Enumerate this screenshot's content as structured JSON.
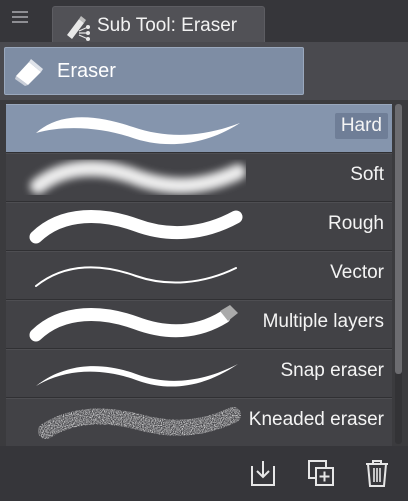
{
  "tab": {
    "title": "Sub Tool: Eraser",
    "icon": "eraser-subtool-icon"
  },
  "group": {
    "label": "Eraser",
    "icon": "eraser-icon"
  },
  "items": [
    {
      "label": "Hard",
      "selected": true
    },
    {
      "label": "Soft",
      "selected": false
    },
    {
      "label": "Rough",
      "selected": false
    },
    {
      "label": "Vector",
      "selected": false
    },
    {
      "label": "Multiple layers",
      "selected": false
    },
    {
      "label": "Snap eraser",
      "selected": false
    },
    {
      "label": "Kneaded eraser",
      "selected": false
    }
  ],
  "footer": {
    "icons": [
      "import-icon",
      "duplicate-icon",
      "delete-icon"
    ]
  },
  "colors": {
    "selected_row": "#8595ad",
    "group_button": "#7e8da4",
    "background": "#3f3f42"
  }
}
